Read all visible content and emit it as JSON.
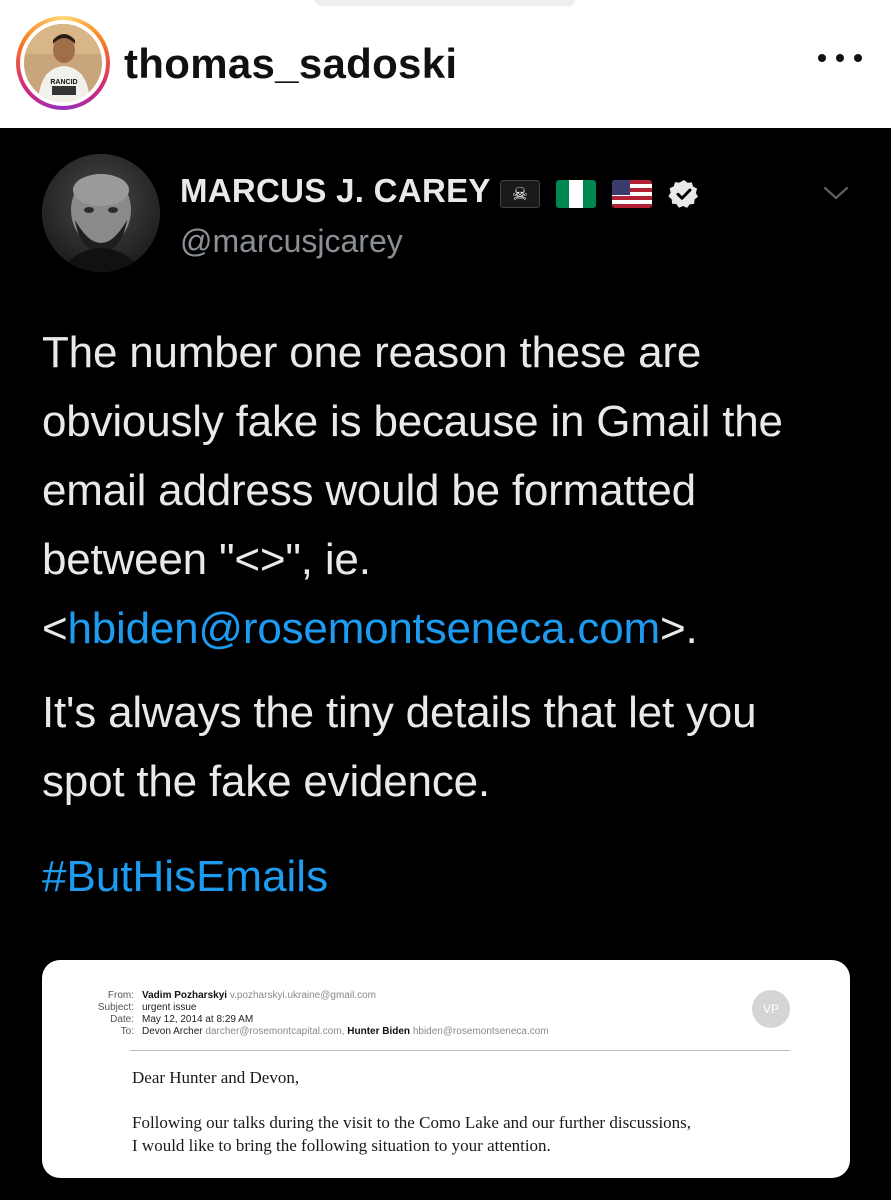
{
  "instagram": {
    "username": "thomas_sadoski",
    "avatar_shirt_text": "RANCID",
    "more_icon": "more-horizontal-icon"
  },
  "tweet": {
    "author_name": "MARCUS J. CAREY",
    "handle": "@marcusjcarey",
    "flags": [
      "pirate-flag",
      "nigeria-flag",
      "us-flag"
    ],
    "verified_icon": "verified-badge-icon",
    "chevron_icon": "chevron-down-icon",
    "paragraph1": {
      "line1": "The number one reason these are",
      "line2": "obviously fake is because in Gmail the",
      "line3": "email address would be formatted",
      "line4": "between \"<>\", ie.",
      "lt": "<",
      "link": "hbiden@rosemontseneca.com",
      "gt_period": ">."
    },
    "paragraph2": {
      "line1": "It's always the tiny details that let you",
      "line2": "spot the fake evidence."
    },
    "hashtag": "#ButHisEmails",
    "colors": {
      "background": "#000000",
      "text": "#e7e9ea",
      "muted": "#8b9096",
      "link": "#1d9bf0"
    }
  },
  "email": {
    "from_label": "From:",
    "from_name": "Vadim Pozharskyi",
    "from_address": "v.pozharskyi.ukraine@gmail.com",
    "subject_label": "Subject:",
    "subject": "urgent issue",
    "date_label": "Date:",
    "date": "May 12, 2014 at 8:29 AM",
    "to_label": "To:",
    "to1_name": "Devon Archer",
    "to1_address": "darcher@rosemontcapital.com,",
    "to2_name": "Hunter Biden",
    "to2_address": "hbiden@rosemontseneca.com",
    "avatar_initials": "VP",
    "greeting": "Dear Hunter and Devon,",
    "body_line1": "Following our talks during the visit to the Como Lake and our further discussions,",
    "body_line2": "I would like to bring the following situation to your attention."
  }
}
